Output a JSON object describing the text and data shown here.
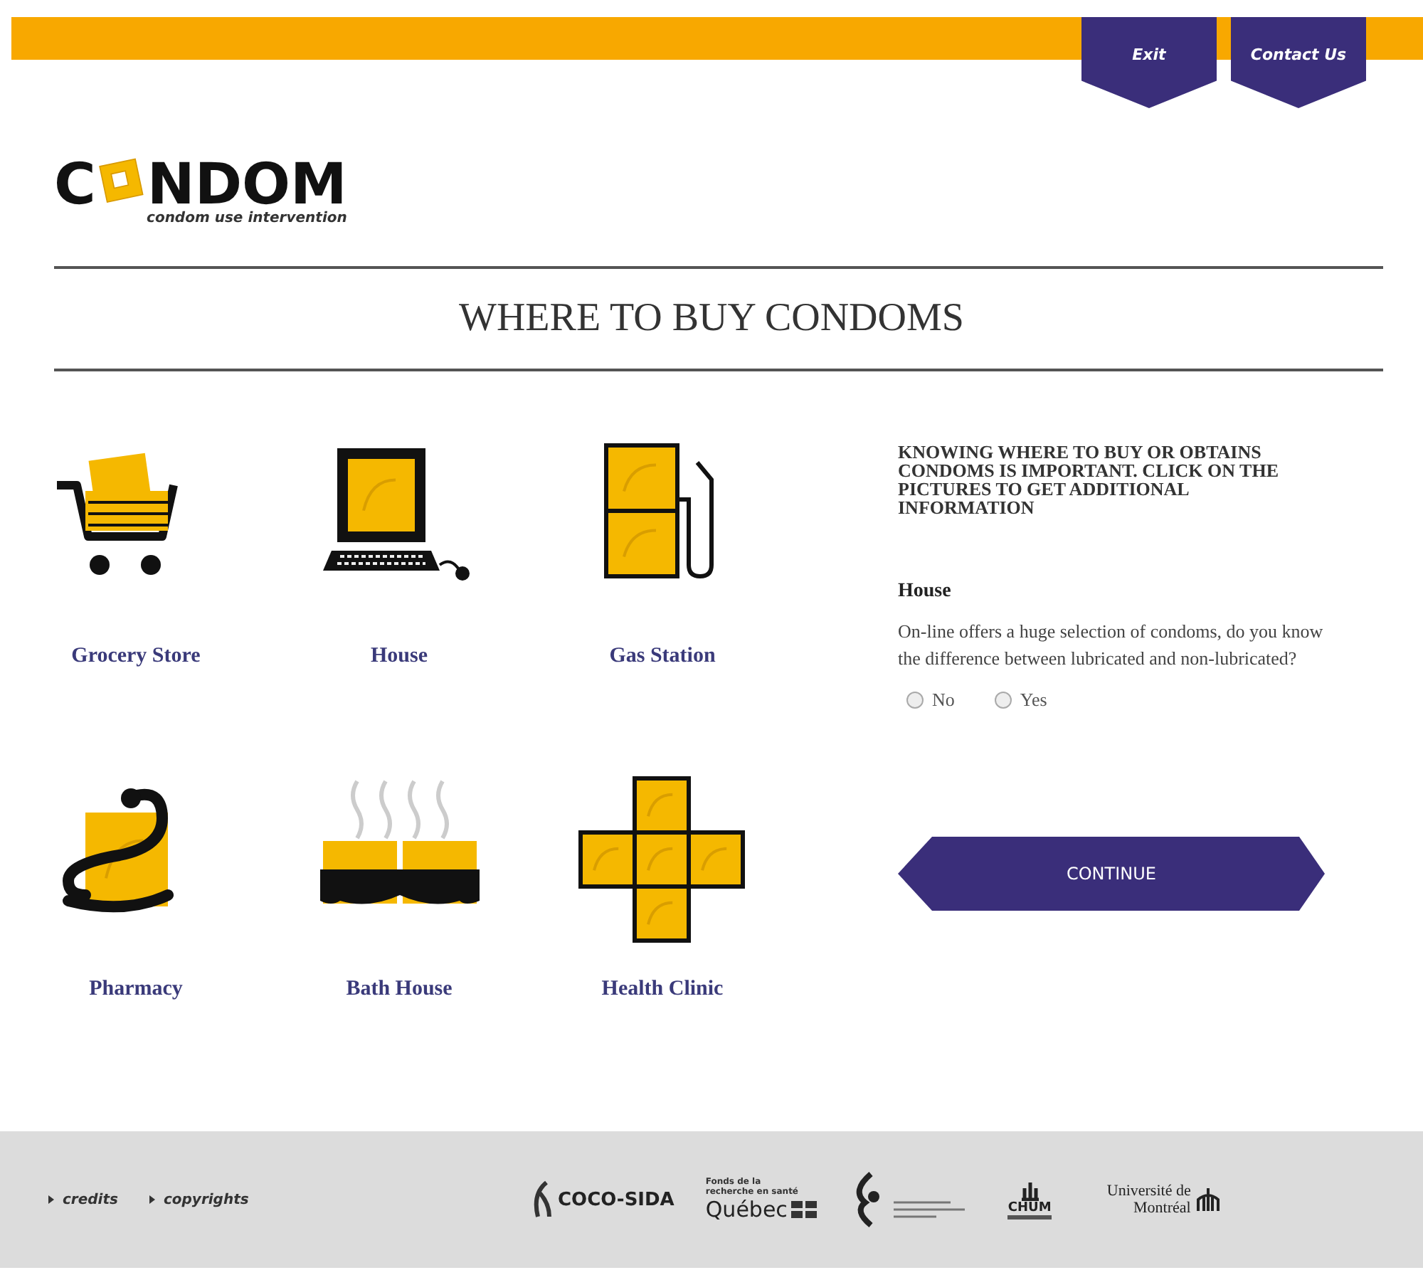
{
  "top_nav": [
    {
      "label": "Exit"
    },
    {
      "label": "Contact Us"
    }
  ],
  "logo": {
    "left": "C",
    "right": "NDOM",
    "tagline": "condom use intervention"
  },
  "page_title": "WHERE TO BUY CONDOMS",
  "places": [
    {
      "kind": "cart",
      "label": "Grocery Store"
    },
    {
      "kind": "computer",
      "label": "House"
    },
    {
      "kind": "pump",
      "label": "Gas Station"
    },
    {
      "kind": "snake",
      "label": "Pharmacy"
    },
    {
      "kind": "bath",
      "label": "Bath House"
    },
    {
      "kind": "cross",
      "label": "Health Clinic"
    }
  ],
  "info_panel": {
    "intro": "KNOWING WHERE TO BUY OR OBTAINS CONDOMS IS IMPORTANT. CLICK ON THE PICTURES TO GET ADDITIONAL INFORMATION",
    "heading": "House",
    "question": "On-line offers a huge selection of condoms, do you know the difference between lubricated and non-lubricated?",
    "options": [
      {
        "label": "No",
        "selected": false
      },
      {
        "label": "Yes",
        "selected": false
      }
    ],
    "continue_button": "CONTINUE"
  },
  "footer": {
    "links": [
      "credits",
      "copyrights"
    ],
    "partners": [
      {
        "kind": "ribbon",
        "name": "COCO-SIDA"
      },
      {
        "kind": "quebec",
        "caption": "Fonds de la recherche en santé",
        "name": "Québec"
      },
      {
        "kind": "swirl"
      },
      {
        "kind": "chum",
        "name": "CHUM"
      },
      {
        "kind": "udem",
        "name": "Université de Montréal"
      }
    ]
  }
}
